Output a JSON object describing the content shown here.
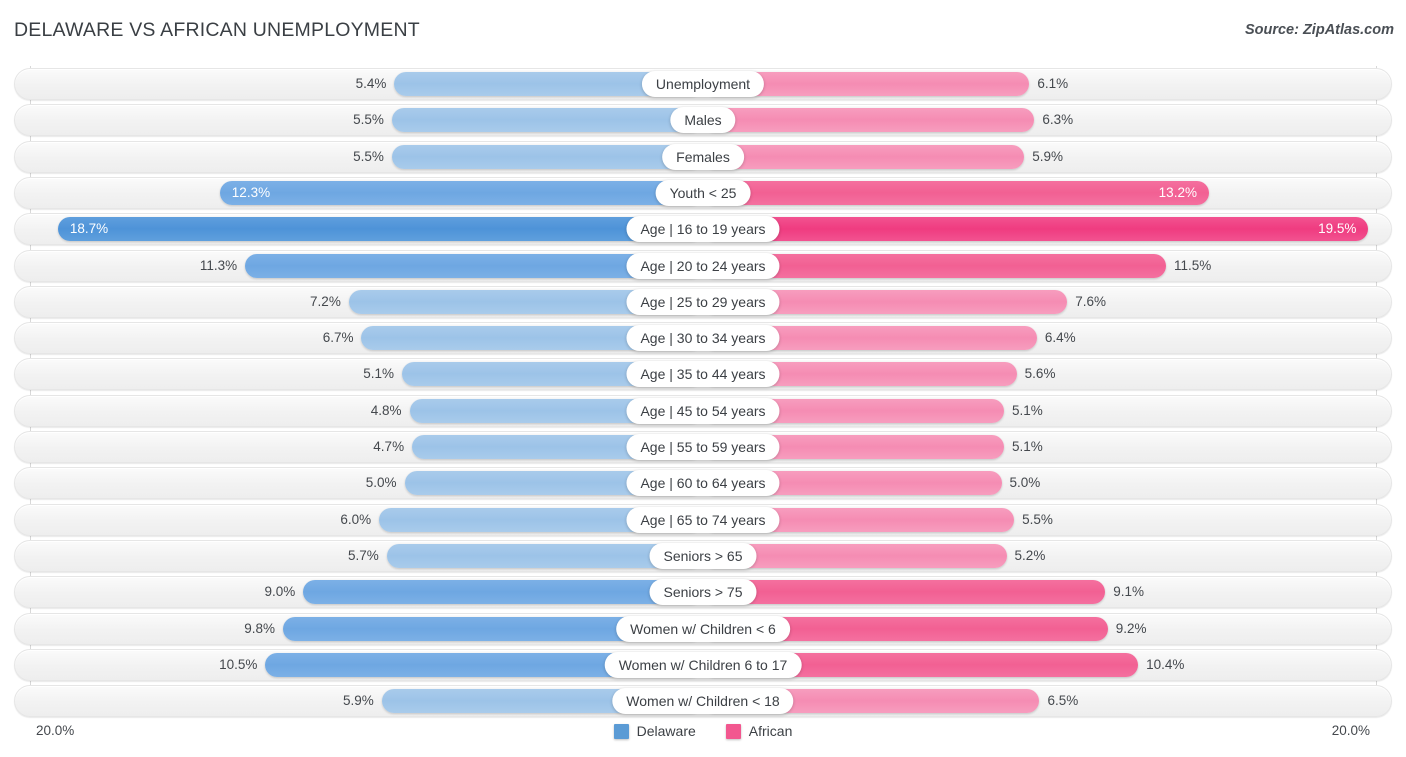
{
  "header": {
    "title": "DELAWARE VS AFRICAN UNEMPLOYMENT",
    "source": "Source: ZipAtlas.com"
  },
  "axis": {
    "left_tick": "20.0%",
    "right_tick": "20.0%",
    "max": 20.0
  },
  "legend": {
    "items": [
      {
        "label": "Delaware",
        "color": "#5b9bd5"
      },
      {
        "label": "African",
        "color": "#f2578f"
      }
    ]
  },
  "colors": {
    "delaware": "#5b9bd5",
    "delaware_light": "#a9cbeb",
    "african": "#f2578f",
    "african_light": "#f79dbe",
    "track": "#f2f2f2",
    "text": "#44484d"
  },
  "chart_data": {
    "type": "bar",
    "title": "DELAWARE VS AFRICAN UNEMPLOYMENT",
    "subtitle": "Source: ZipAtlas.com",
    "orientation": "horizontal-diverging",
    "xlabel": "",
    "ylabel": "",
    "xlim": [
      20.0,
      20.0
    ],
    "grid": false,
    "legend_position": "bottom-center",
    "categories": [
      "Unemployment",
      "Males",
      "Females",
      "Youth < 25",
      "Age | 16 to 19 years",
      "Age | 20 to 24 years",
      "Age | 25 to 29 years",
      "Age | 30 to 34 years",
      "Age | 35 to 44 years",
      "Age | 45 to 54 years",
      "Age | 55 to 59 years",
      "Age | 60 to 64 years",
      "Age | 65 to 74 years",
      "Seniors > 65",
      "Seniors > 75",
      "Women w/ Children < 6",
      "Women w/ Children 6 to 17",
      "Women w/ Children < 18"
    ],
    "series": [
      {
        "name": "Delaware",
        "color": "#5b9bd5",
        "values": [
          5.4,
          5.5,
          5.5,
          12.3,
          18.7,
          11.3,
          7.2,
          6.7,
          5.1,
          4.8,
          4.7,
          5.0,
          6.0,
          5.7,
          9.0,
          9.8,
          10.5,
          5.9
        ]
      },
      {
        "name": "African",
        "color": "#f2578f",
        "values": [
          6.1,
          6.3,
          5.9,
          13.2,
          19.5,
          11.5,
          7.6,
          6.4,
          5.6,
          5.1,
          5.1,
          5.0,
          5.5,
          5.2,
          9.1,
          9.2,
          10.4,
          6.5
        ]
      }
    ]
  },
  "rows": [
    {
      "label": "Unemployment",
      "left": "5.4%",
      "right": "6.1%",
      "lv": 5.4,
      "rv": 6.1,
      "emphasis": 0,
      "left_inside": false,
      "right_inside": false
    },
    {
      "label": "Males",
      "left": "5.5%",
      "right": "6.3%",
      "lv": 5.5,
      "rv": 6.3,
      "emphasis": 0,
      "left_inside": false,
      "right_inside": false
    },
    {
      "label": "Females",
      "left": "5.5%",
      "right": "5.9%",
      "lv": 5.5,
      "rv": 5.9,
      "emphasis": 0,
      "left_inside": false,
      "right_inside": false
    },
    {
      "label": "Youth < 25",
      "left": "12.3%",
      "right": "13.2%",
      "lv": 12.3,
      "rv": 13.2,
      "emphasis": 1,
      "left_inside": true,
      "right_inside": true
    },
    {
      "label": "Age | 16 to 19 years",
      "left": "18.7%",
      "right": "19.5%",
      "lv": 18.7,
      "rv": 19.5,
      "emphasis": 2,
      "left_inside": true,
      "right_inside": true
    },
    {
      "label": "Age | 20 to 24 years",
      "left": "11.3%",
      "right": "11.5%",
      "lv": 11.3,
      "rv": 11.5,
      "emphasis": 1,
      "left_inside": false,
      "right_inside": false
    },
    {
      "label": "Age | 25 to 29 years",
      "left": "7.2%",
      "right": "7.6%",
      "lv": 7.2,
      "rv": 7.6,
      "emphasis": 0,
      "left_inside": false,
      "right_inside": false
    },
    {
      "label": "Age | 30 to 34 years",
      "left": "6.7%",
      "right": "6.4%",
      "lv": 6.7,
      "rv": 6.4,
      "emphasis": 0,
      "left_inside": false,
      "right_inside": false
    },
    {
      "label": "Age | 35 to 44 years",
      "left": "5.1%",
      "right": "5.6%",
      "lv": 5.1,
      "rv": 5.6,
      "emphasis": 0,
      "left_inside": false,
      "right_inside": false
    },
    {
      "label": "Age | 45 to 54 years",
      "left": "4.8%",
      "right": "5.1%",
      "lv": 4.8,
      "rv": 5.1,
      "emphasis": 0,
      "left_inside": false,
      "right_inside": false
    },
    {
      "label": "Age | 55 to 59 years",
      "left": "4.7%",
      "right": "5.1%",
      "lv": 4.7,
      "rv": 5.1,
      "emphasis": 0,
      "left_inside": false,
      "right_inside": false
    },
    {
      "label": "Age | 60 to 64 years",
      "left": "5.0%",
      "right": "5.0%",
      "lv": 5.0,
      "rv": 5.0,
      "emphasis": 0,
      "left_inside": false,
      "right_inside": false
    },
    {
      "label": "Age | 65 to 74 years",
      "left": "6.0%",
      "right": "5.5%",
      "lv": 6.0,
      "rv": 5.5,
      "emphasis": 0,
      "left_inside": false,
      "right_inside": false
    },
    {
      "label": "Seniors > 65",
      "left": "5.7%",
      "right": "5.2%",
      "lv": 5.7,
      "rv": 5.2,
      "emphasis": 0,
      "left_inside": false,
      "right_inside": false
    },
    {
      "label": "Seniors > 75",
      "left": "9.0%",
      "right": "9.1%",
      "lv": 9.0,
      "rv": 9.1,
      "emphasis": 1,
      "left_inside": false,
      "right_inside": false
    },
    {
      "label": "Women w/ Children < 6",
      "left": "9.8%",
      "right": "9.2%",
      "lv": 9.8,
      "rv": 9.2,
      "emphasis": 1,
      "left_inside": false,
      "right_inside": false
    },
    {
      "label": "Women w/ Children 6 to 17",
      "left": "10.5%",
      "right": "10.4%",
      "lv": 10.5,
      "rv": 10.4,
      "emphasis": 1,
      "left_inside": false,
      "right_inside": false
    },
    {
      "label": "Women w/ Children < 18",
      "left": "5.9%",
      "right": "6.5%",
      "lv": 5.9,
      "rv": 6.5,
      "emphasis": 0,
      "left_inside": false,
      "right_inside": false
    }
  ]
}
